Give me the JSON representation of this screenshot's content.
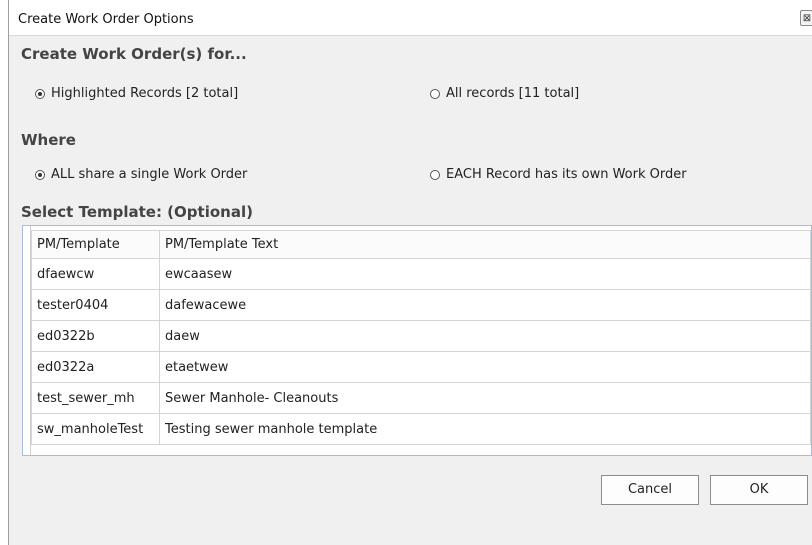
{
  "window": {
    "title": "Create Work Order Options",
    "close_glyph": "⊠"
  },
  "create_for": {
    "heading": "Create Work Order(s) for...",
    "options": [
      {
        "label": "Highlighted Records [2 total]",
        "checked": true
      },
      {
        "label": "All records [11 total]",
        "checked": false
      }
    ]
  },
  "where": {
    "heading": "Where",
    "options": [
      {
        "label": "ALL share a single Work Order",
        "checked": true
      },
      {
        "label": "EACH Record has its own Work Order",
        "checked": false
      }
    ]
  },
  "template": {
    "heading": "Select Template: (Optional)",
    "columns": [
      "PM/Template",
      "PM/Template Text"
    ],
    "rows": [
      [
        "dfaewcw",
        "ewcaasew"
      ],
      [
        "tester0404",
        "dafewacewe"
      ],
      [
        "ed0322b",
        "daew"
      ],
      [
        "ed0322a",
        "etaetwew"
      ],
      [
        "test_sewer_mh",
        "Sewer Manhole- Cleanouts"
      ],
      [
        "sw_manholeTest",
        "Testing sewer manhole template"
      ]
    ]
  },
  "buttons": {
    "cancel": "Cancel",
    "ok": "OK"
  }
}
